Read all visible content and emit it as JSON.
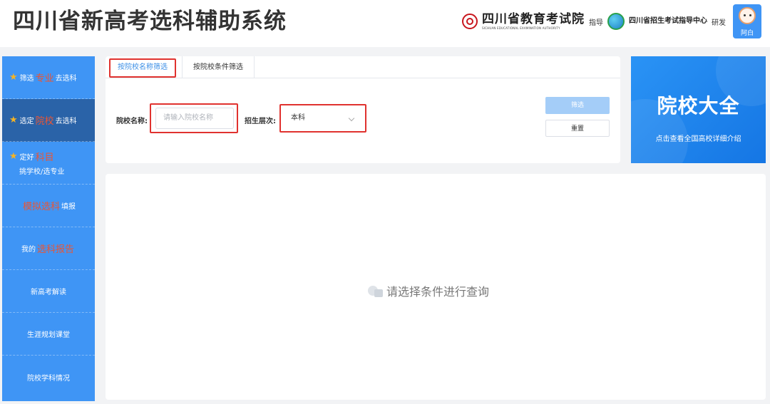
{
  "header": {
    "title": "四川省新高考选科辅助系统",
    "org1_name": "四川省教育考试院",
    "org1_en": "SICHUAN EDUCATIONAL EXAMINATION AUTHORITY",
    "guide_text": "指导",
    "org2_name": "四川省招生考试指导中心",
    "dev_text": "研发",
    "user_name": "阿白"
  },
  "sidebar": {
    "items": [
      {
        "prefix": "筛选",
        "highlight": "专业",
        "suffix": "去选科"
      },
      {
        "prefix": "选定",
        "highlight": "院校",
        "suffix": "去选科"
      },
      {
        "prefix": "定好",
        "highlight": "科目",
        "line2": "挑学校/选专业"
      },
      {
        "highlight": "模拟选科",
        "suffix": "填报"
      },
      {
        "prefix": "我的",
        "highlight": "选科报告"
      },
      {
        "label": "新高考解读"
      },
      {
        "label": "生涯规划课堂"
      },
      {
        "label": "院校学科情况"
      }
    ]
  },
  "filter": {
    "tabs": [
      "按院校名称筛选",
      "按院校条件筛选"
    ],
    "name_label": "院校名称:",
    "name_placeholder": "请输入院校名称",
    "level_label": "招生层次:",
    "level_value": "本科",
    "filter_button": "筛选",
    "reset_button": "重置"
  },
  "promo": {
    "title": "院校大全",
    "subtitle": "点击查看全国高校详细介绍"
  },
  "results": {
    "empty_text": "请选择条件进行查询"
  },
  "colors": {
    "primary": "#3f95f5",
    "sidebar_active": "#2a63a8",
    "highlight_red": "#e0322f",
    "accent_orange": "#ea5534"
  }
}
